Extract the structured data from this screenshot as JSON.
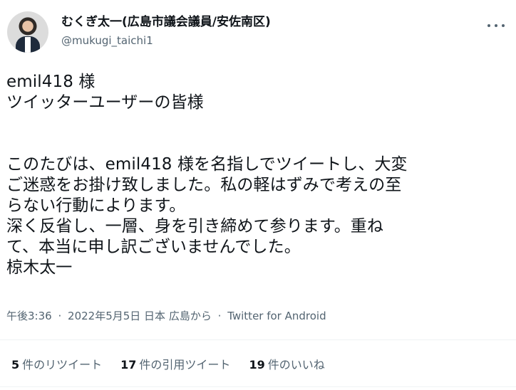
{
  "author": {
    "display_name": "むくぎ太一(広島市議会議員/安佐南区)",
    "handle": "@mukugi_taichi1"
  },
  "tweet": {
    "lines_1": [
      "emil418 様",
      "ツイッターユーザーの皆様"
    ],
    "lines_2": [
      "このたびは、emil418 様を名指しでツイートし、大変",
      "ご迷惑をお掛け致しました。私の軽はずみで考えの至",
      "らない行動によります。",
      "深く反省し、一層、身を引き締めて参ります。重ね",
      "て、本当に申し訳ございませんでした。",
      "椋木太一"
    ],
    "time": "午後3:36",
    "date": "2022年5月5日 日本 広島から",
    "separator": "·",
    "client": "Twitter for Android"
  },
  "stats": [
    {
      "count": "5",
      "label": "件のリツイート"
    },
    {
      "count": "17",
      "label": "件の引用ツイート"
    },
    {
      "count": "19",
      "label": "件のいいね"
    }
  ],
  "colors": {
    "text_primary": "#0f1419",
    "text_secondary": "#536471",
    "divider": "#eff3f4"
  },
  "icons": {
    "more": "more-horizontal-icon",
    "avatar": "profile-photo"
  }
}
